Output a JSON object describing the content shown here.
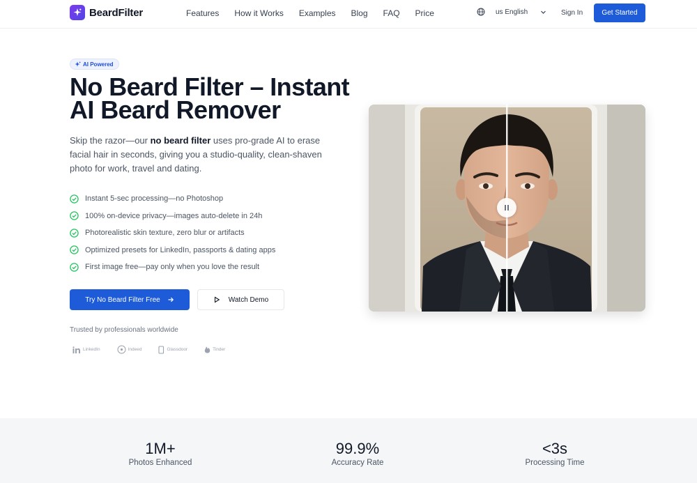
{
  "nav": {
    "brand": "BeardFilter",
    "links": [
      "Features",
      "How it Works",
      "Examples",
      "Blog",
      "FAQ",
      "Price"
    ],
    "language": "us English",
    "sign_in": "Sign In",
    "get_started": "Get Started"
  },
  "hero": {
    "badge": "AI Powered",
    "title_line1": "No Beard Filter – Instant",
    "title_line2": "AI Beard Remover",
    "intro_before": "Skip the razor—our ",
    "intro_bold": "no beard filter",
    "intro_after": " uses pro-grade AI to erase facial hair in seconds, giving you a studio-quality, clean-shaven photo for work, travel and dating.",
    "features": [
      "Instant 5-sec processing—no Photoshop",
      "100% on-device privacy—images auto-delete in 24h",
      "Photorealistic skin texture, zero blur or artifacts",
      "Optimized presets for LinkedIn, passports & dating apps",
      "First image free—pay only when you love the result"
    ],
    "cta_primary": "Try No Beard Filter Free",
    "cta_secondary": "Watch Demo",
    "trusted": "Trusted by professionals worldwide",
    "logos": [
      "LinkedIn",
      "Indeed",
      "Glassdoor",
      "Tinder"
    ]
  },
  "stats": [
    {
      "value": "1M+",
      "label": "Photos Enhanced"
    },
    {
      "value": "99.9%",
      "label": "Accuracy Rate"
    },
    {
      "value": "<3s",
      "label": "Processing Time"
    }
  ],
  "colors": {
    "accent": "#1d5bd8",
    "check": "#22c55e",
    "brand_gradient_start": "#7c3aed",
    "brand_gradient_end": "#4f46e5"
  },
  "icons": {
    "brand": "sparkle-icon",
    "language": "globe-icon",
    "language_toggle": "chevron-down-icon",
    "feature": "check-circle-icon",
    "cta_primary": "arrow-right-icon",
    "cta_secondary": "play-icon",
    "slider": "pause-icon"
  }
}
